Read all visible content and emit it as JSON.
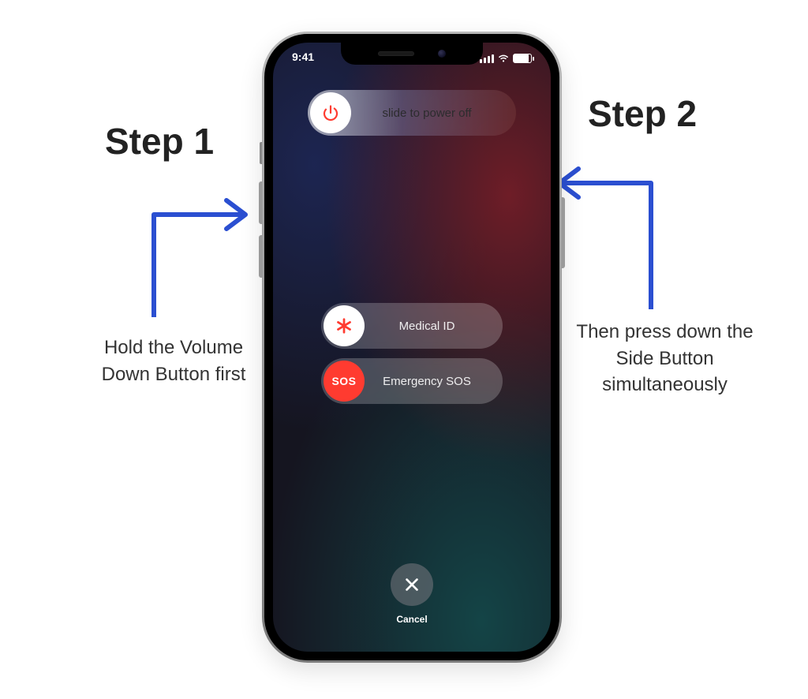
{
  "annotations": {
    "step1": {
      "heading": "Step 1",
      "text": "Hold the Volume Down Button first"
    },
    "step2": {
      "heading": "Step 2",
      "text": "Then press down the Side Button simultaneously"
    }
  },
  "statusbar": {
    "time": "9:41"
  },
  "sliders": {
    "power": {
      "label": "slide to power off",
      "icon": "power-icon"
    },
    "medical": {
      "label": "Medical ID",
      "icon": "asterisk-icon"
    },
    "sos": {
      "label": "Emergency SOS",
      "icon_text": "SOS"
    }
  },
  "cancel": {
    "label": "Cancel"
  },
  "colors": {
    "blue_arrow": "#2b4fd1",
    "sos_red": "#ff3b30"
  }
}
